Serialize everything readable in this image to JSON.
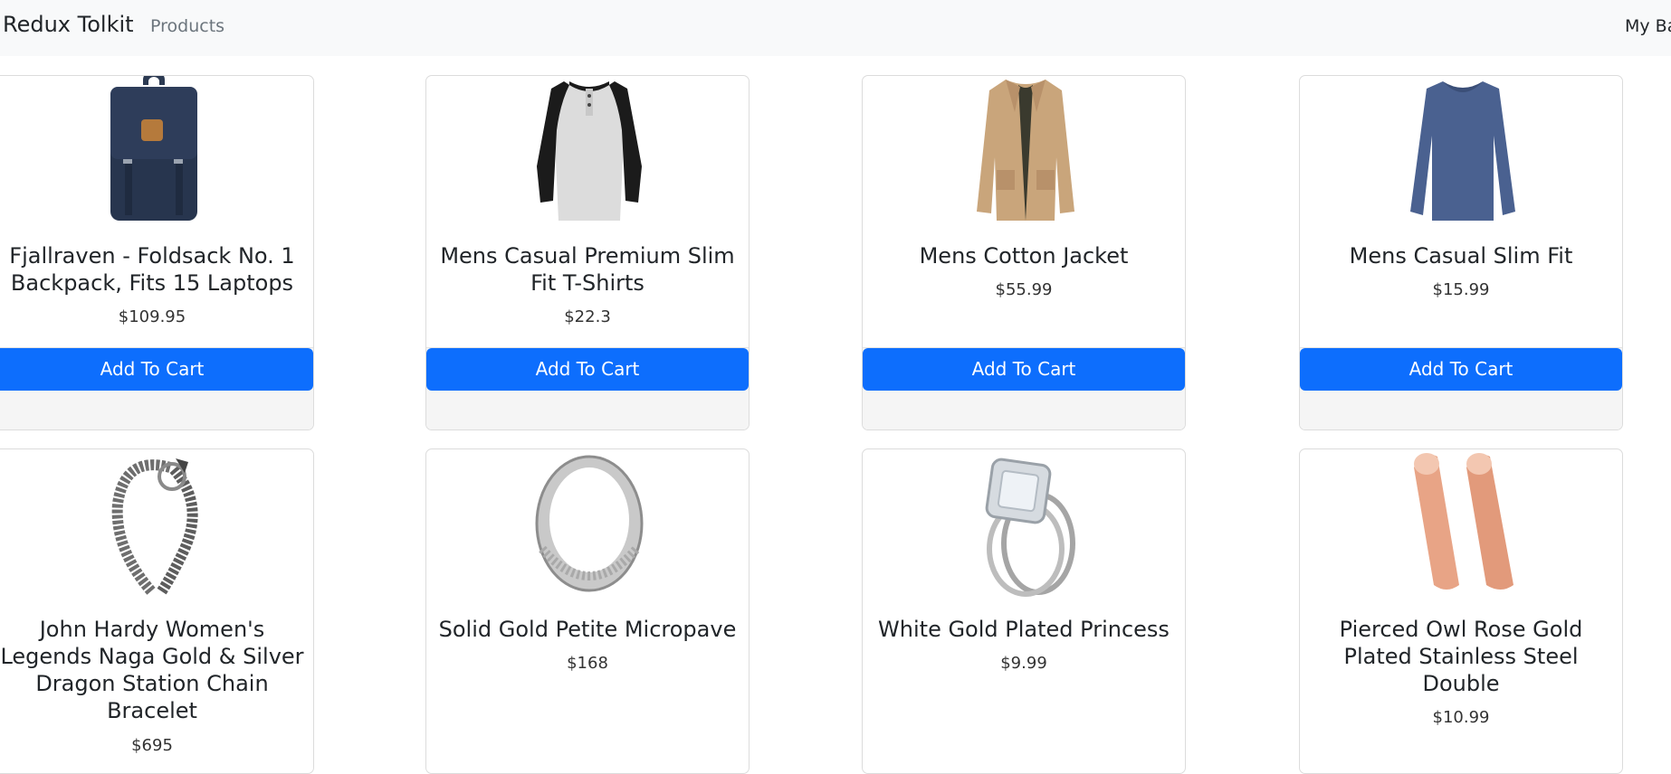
{
  "nav": {
    "brand": "Redux Tolkit",
    "products_link": "Products",
    "bag_link": "My Bag"
  },
  "products": [
    {
      "title": "Fjallraven - Foldsack No. 1 Backpack, Fits 15 Laptops",
      "price": "$109.95",
      "button": "Add To Cart",
      "image_icon": "backpack-image"
    },
    {
      "title": "Mens Casual Premium Slim Fit T-Shirts",
      "price": "$22.3",
      "button": "Add To Cart",
      "image_icon": "raglan-shirt-image"
    },
    {
      "title": "Mens Cotton Jacket",
      "price": "$55.99",
      "button": "Add To Cart",
      "image_icon": "jacket-image"
    },
    {
      "title": "Mens Casual Slim Fit",
      "price": "$15.99",
      "button": "Add To Cart",
      "image_icon": "longsleeve-shirt-image"
    },
    {
      "title": "John Hardy Women's Legends Naga Gold & Silver Dragon Station Chain Bracelet",
      "price": "$695",
      "image_icon": "bracelet-image"
    },
    {
      "title": "Solid Gold Petite Micropave",
      "price": "$168",
      "image_icon": "silver-ring-image"
    },
    {
      "title": "White Gold Plated Princess",
      "price": "$9.99",
      "image_icon": "diamond-ring-image"
    },
    {
      "title": "Pierced Owl Rose Gold Plated Stainless Steel Double",
      "price": "$10.99",
      "image_icon": "rose-gold-plugs-image"
    }
  ],
  "colors": {
    "primary": "#0d6efd",
    "navbar_bg": "#f8f9fa",
    "card_footer_bg": "#f5f5f5"
  }
}
